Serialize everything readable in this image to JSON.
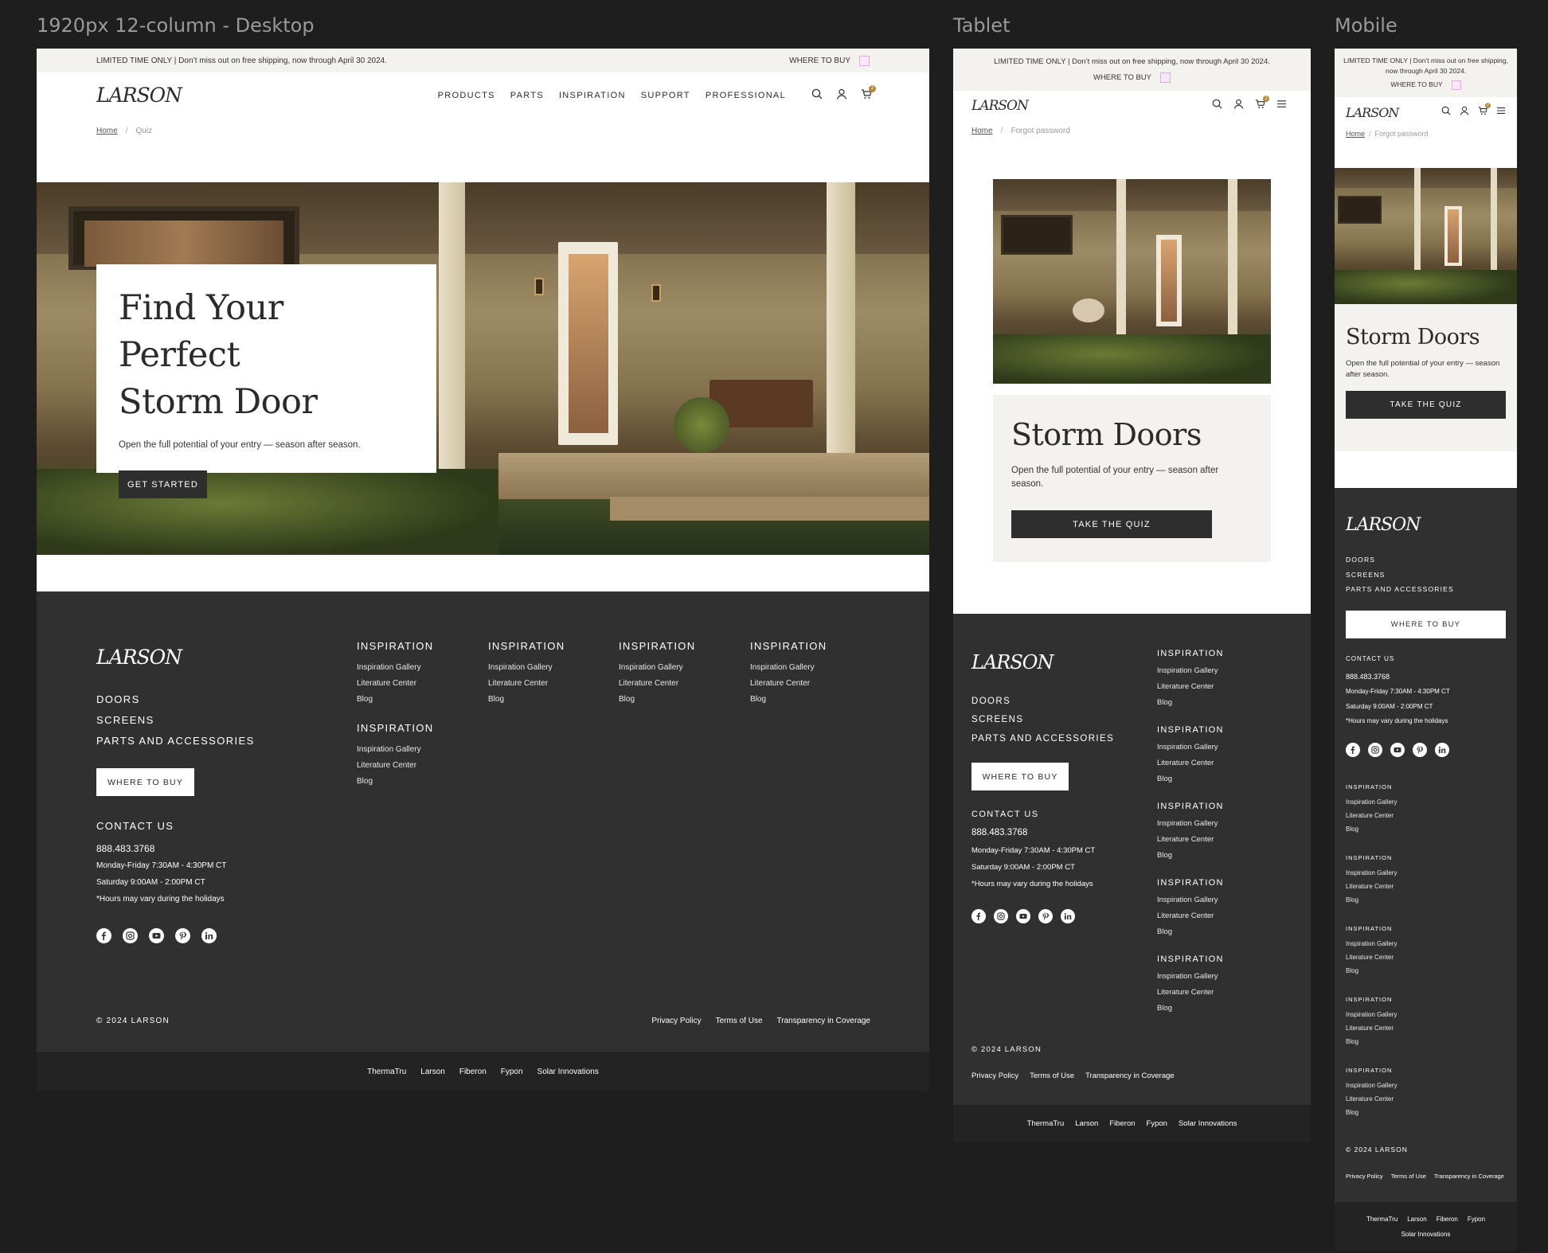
{
  "labels": {
    "desktop": "1920px 12-column - Desktop",
    "tablet": "Tablet",
    "mobile": "Mobile"
  },
  "promo": {
    "text": "LIMITED TIME ONLY | Don’t miss out on free shipping, now through April 30 2024.",
    "where_to_buy": "WHERE TO BUY"
  },
  "brand": {
    "logo": "LARSON"
  },
  "nav": [
    "PRODUCTS",
    "PARTS",
    "INSPIRATION",
    "SUPPORT",
    "PROFESSIONAL"
  ],
  "cart_count": "2",
  "desktop": {
    "breadcrumb": {
      "home": "Home",
      "sep": "/",
      "current": "Quiz"
    },
    "hero": {
      "title_line1": "Find Your Perfect",
      "title_line2": "Storm Door",
      "subtitle": "Open the full potential of your entry — season after season.",
      "cta": "GET STARTED"
    }
  },
  "tablet": {
    "breadcrumb": {
      "home": "Home",
      "sep": "/",
      "current": "Forgot password"
    },
    "hero": {
      "title": "Storm Doors",
      "subtitle": "Open the full potential of your entry — season after season.",
      "cta": "TAKE THE QUIZ"
    }
  },
  "mobile": {
    "breadcrumb": {
      "home": "Home",
      "sep": "/",
      "current": "Forgot password"
    },
    "hero": {
      "title": "Storm Doors",
      "subtitle": "Open the full potential of your entry — season after season.",
      "cta": "TAKE THE QUIZ"
    }
  },
  "footer": {
    "side_links": [
      "DOORS",
      "SCREENS",
      "PARTS AND ACCESSORIES"
    ],
    "where_to_buy": "WHERE TO BUY",
    "contact_heading": "CONTACT US",
    "phone": "888.483.3768",
    "hours_weekday": "Monday-Friday 7:30AM - 4:30PM CT",
    "hours_saturday": "Saturday 9:00AM - 2:00PM CT",
    "hours_note": "*Hours may vary during the holidays",
    "column_heading": "INSPIRATION",
    "column_links": [
      "Inspiration Gallery",
      "Literature Center",
      "Blog"
    ],
    "copyright": "© 2024 LARSON",
    "legal": [
      "Privacy Policy",
      "Terms of Use",
      "Transparency in Coverage"
    ],
    "brands": [
      "ThermaTru",
      "Larson",
      "Fiberon",
      "Fypon",
      "Solar Innovations"
    ]
  },
  "socials": [
    "facebook-icon",
    "instagram-icon",
    "youtube-icon",
    "pinterest-icon",
    "linkedin-icon"
  ]
}
